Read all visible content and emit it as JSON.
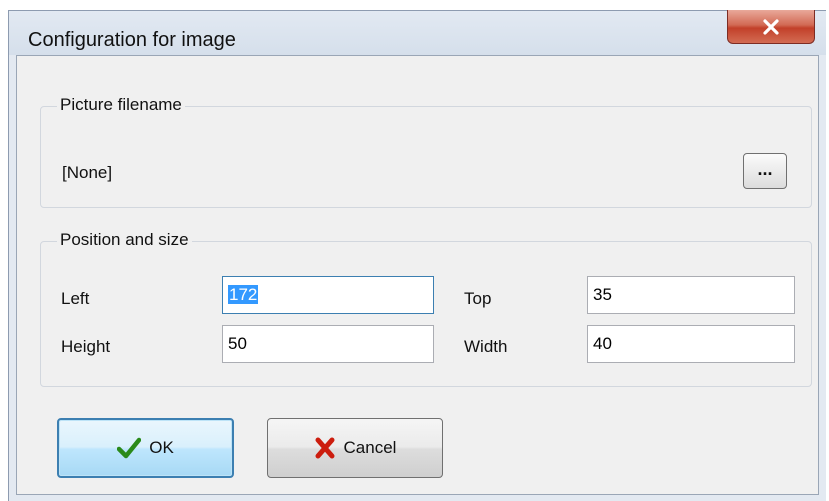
{
  "window": {
    "title": "Configuration for image",
    "close_icon": "close-icon"
  },
  "picture_group": {
    "title": "Picture filename",
    "filename": "[None]",
    "browse_label": "..."
  },
  "position_group": {
    "title": "Position and size",
    "fields": {
      "left": {
        "label": "Left",
        "value": "172"
      },
      "top": {
        "label": "Top",
        "value": "35"
      },
      "height": {
        "label": "Height",
        "value": "50"
      },
      "width": {
        "label": "Width",
        "value": "40"
      }
    }
  },
  "buttons": {
    "ok": {
      "label": "OK",
      "icon": "checkmark-icon",
      "color": "#2a8a1a"
    },
    "cancel": {
      "label": "Cancel",
      "icon": "red-x-icon",
      "color": "#cc1d0e"
    }
  },
  "colors": {
    "close_button": "#c7472f",
    "selection": "#3399ff",
    "focus_border": "#3c7fb1"
  }
}
